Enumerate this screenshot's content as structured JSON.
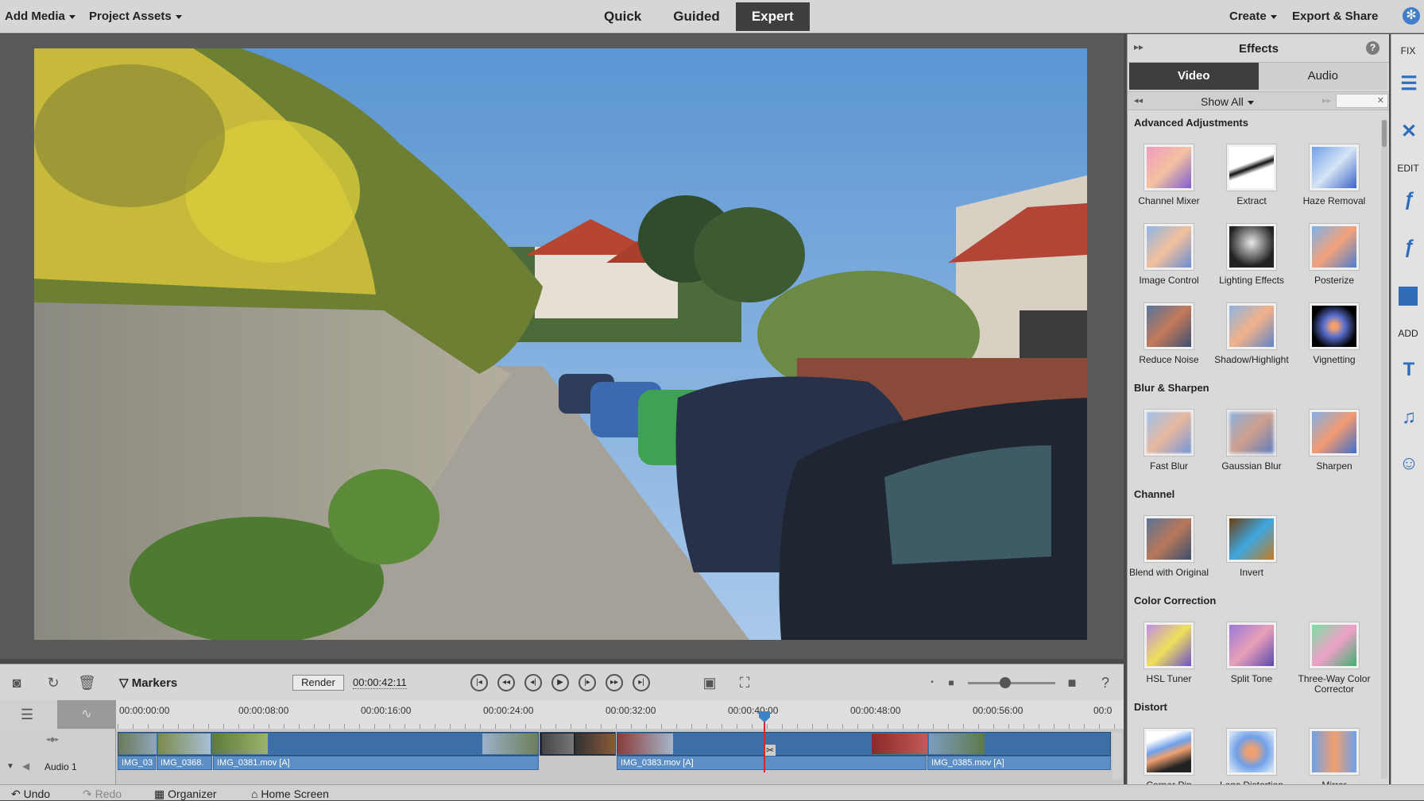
{
  "topbar": {
    "add_media": "Add Media",
    "project_assets": "Project Assets",
    "modes": [
      "Quick",
      "Guided",
      "Expert"
    ],
    "active_mode": "Expert",
    "create": "Create",
    "export_share": "Export & Share"
  },
  "effects_panel": {
    "title": "Effects",
    "tabs": [
      "Video",
      "Audio"
    ],
    "filter": "Show All",
    "categories": [
      {
        "name": "Advanced Adjustments",
        "effects": [
          "Channel Mixer",
          "Extract",
          "Haze Removal",
          "Image Control",
          "Lighting Effects",
          "Posterize",
          "Reduce Noise",
          "Shadow/Highlight",
          "Vignetting"
        ]
      },
      {
        "name": "Blur & Sharpen",
        "effects": [
          "Fast Blur",
          "Gaussian Blur",
          "Sharpen"
        ]
      },
      {
        "name": "Channel",
        "effects": [
          "Blend with Original",
          "Invert"
        ]
      },
      {
        "name": "Color Correction",
        "effects": [
          "HSL Tuner",
          "Split Tone",
          "Three-Way Color Corrector"
        ]
      },
      {
        "name": "Distort",
        "effects": [
          "Corner Pin",
          "Lens Distortion",
          "Mirror"
        ]
      }
    ]
  },
  "right_sidebar": {
    "fix": "FIX",
    "edit": "EDIT",
    "add": "ADD"
  },
  "timeline": {
    "markers": "Markers",
    "render": "Render",
    "timecode": "00:00:42:11",
    "ruler": [
      "00:00:00:00",
      "00:00:08:00",
      "00:00:16:00",
      "00:00:24:00",
      "00:00:32:00",
      "00:00:40:00",
      "00:00:48:00",
      "00:00:56:00",
      "00:0"
    ],
    "audio_track": "Audio 1",
    "audio_clips": [
      "IMG_03",
      "IMG_0368.",
      "IMG_0381.mov [A]",
      "IMG_0383.mov [A]",
      "IMG_0385.mov [A]"
    ]
  },
  "bottombar": {
    "undo": "Undo",
    "redo": "Redo",
    "organizer": "Organizer",
    "home": "Home Screen"
  },
  "colors": {
    "accent": "#3e3e3e",
    "brand_blue": "#3d82c7",
    "playhead": "#d8282f"
  }
}
